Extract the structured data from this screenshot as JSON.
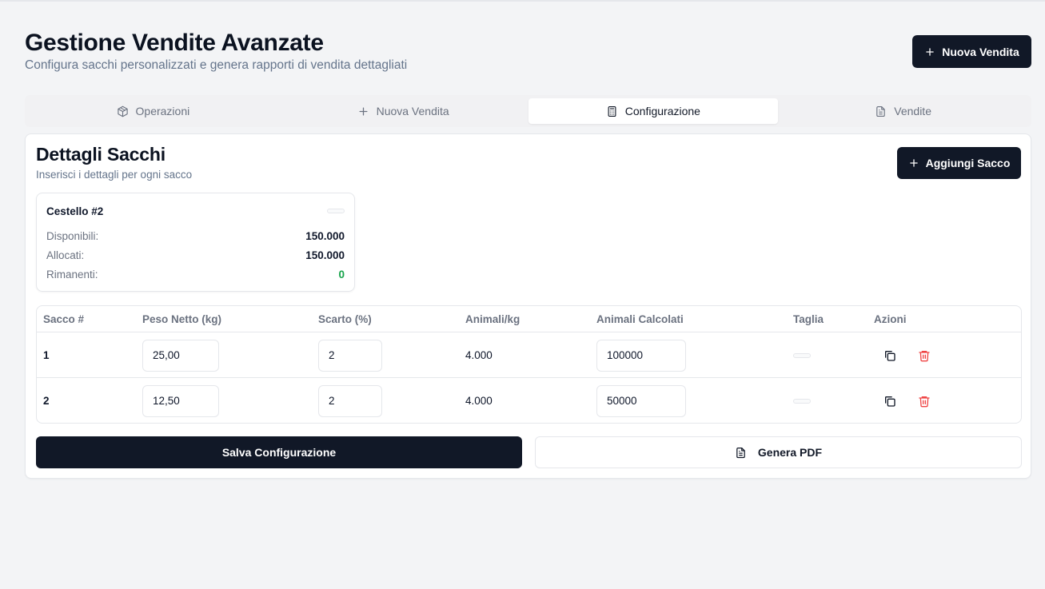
{
  "header": {
    "title": "Gestione Vendite Avanzate",
    "subtitle": "Configura sacchi personalizzati e genera rapporti di vendita dettagliati",
    "new_sale_button": "Nuova Vendita"
  },
  "tabs": [
    {
      "label": "Operazioni",
      "icon": "package-icon",
      "active": false
    },
    {
      "label": "Nuova Vendita",
      "icon": "plus-icon",
      "active": false
    },
    {
      "label": "Configurazione",
      "icon": "calculator-icon",
      "active": true
    },
    {
      "label": "Vendite",
      "icon": "file-text-icon",
      "active": false
    }
  ],
  "card": {
    "title": "Dettagli Sacchi",
    "subtitle": "Inserisci i dettagli per ogni sacco",
    "add_button": "Aggiungi Sacco"
  },
  "summary": {
    "title": "Cestello #2",
    "rows": [
      {
        "label": "Disponibili:",
        "value": "150.000"
      },
      {
        "label": "Allocati:",
        "value": "150.000"
      },
      {
        "label": "Rimanenti:",
        "value": "0"
      }
    ]
  },
  "table": {
    "headers": [
      "Sacco #",
      "Peso Netto (kg)",
      "Scarto (%)",
      "Animali/kg",
      "Animali Calcolati",
      "Taglia",
      "Azioni"
    ],
    "rows": [
      {
        "sacco": "1",
        "peso": "25,00",
        "scarto": "2",
        "animali_kg": "4.000",
        "animali_calcolati": "100000"
      },
      {
        "sacco": "2",
        "peso": "12,50",
        "scarto": "2",
        "animali_kg": "4.000",
        "animali_calcolati": "50000"
      }
    ]
  },
  "actions": {
    "save_button": "Salva Configurazione",
    "pdf_button": "Genera PDF"
  },
  "colors": {
    "primary": "#111827",
    "danger": "#ef4444",
    "success": "#16a34a"
  }
}
